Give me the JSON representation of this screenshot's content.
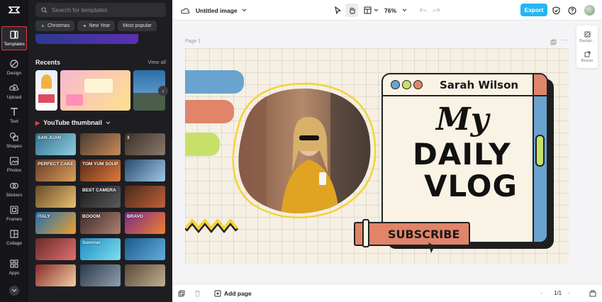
{
  "rail": {
    "items": [
      {
        "label": "Templates",
        "icon": "templates-icon"
      },
      {
        "label": "Design",
        "icon": "design-icon"
      },
      {
        "label": "Upload",
        "icon": "upload-icon"
      },
      {
        "label": "Text",
        "icon": "text-icon"
      },
      {
        "label": "Shapes",
        "icon": "shapes-icon"
      },
      {
        "label": "Photos",
        "icon": "photos-icon"
      },
      {
        "label": "Stickers",
        "icon": "stickers-icon"
      },
      {
        "label": "Frames",
        "icon": "frames-icon"
      },
      {
        "label": "Collage",
        "icon": "collage-icon"
      },
      {
        "label": "Apps",
        "icon": "apps-icon"
      }
    ]
  },
  "panel": {
    "search_placeholder": "Search for templates",
    "chips": [
      "Christmas",
      "New Year",
      "Most popular"
    ],
    "recents_title": "Recents",
    "view_all": "View all",
    "yt_title": "YouTube thumbnail",
    "thumb_texts": [
      "SAN JUAN",
      "",
      "3",
      "PERFECT CAKE",
      "TOM YUM SOUP",
      "",
      "",
      "BEST CAMERA",
      "",
      "ITALY",
      "BOOOM",
      "BRAVO",
      "",
      "Summer",
      "",
      "",
      "",
      ""
    ]
  },
  "topbar": {
    "title": "Untitled image",
    "zoom": "76%",
    "export": "Export"
  },
  "stage": {
    "page_label": "Page 1",
    "right_panel": [
      "Backgr...",
      "Resize"
    ]
  },
  "design": {
    "name": "Sarah Wilson",
    "line1": "My",
    "line2": "DAILY",
    "line3": "VLOG",
    "button": "SUBSCRIBE"
  },
  "bottombar": {
    "add_page": "Add page",
    "page_count": "1/1"
  },
  "colors": {
    "accent": "#25b6f0",
    "rail_active_border": "#e03a3a",
    "design_blue": "#6aa3cf",
    "design_orange": "#e0846a",
    "design_green": "#c7e06a",
    "design_yellow": "#f5d23a"
  }
}
